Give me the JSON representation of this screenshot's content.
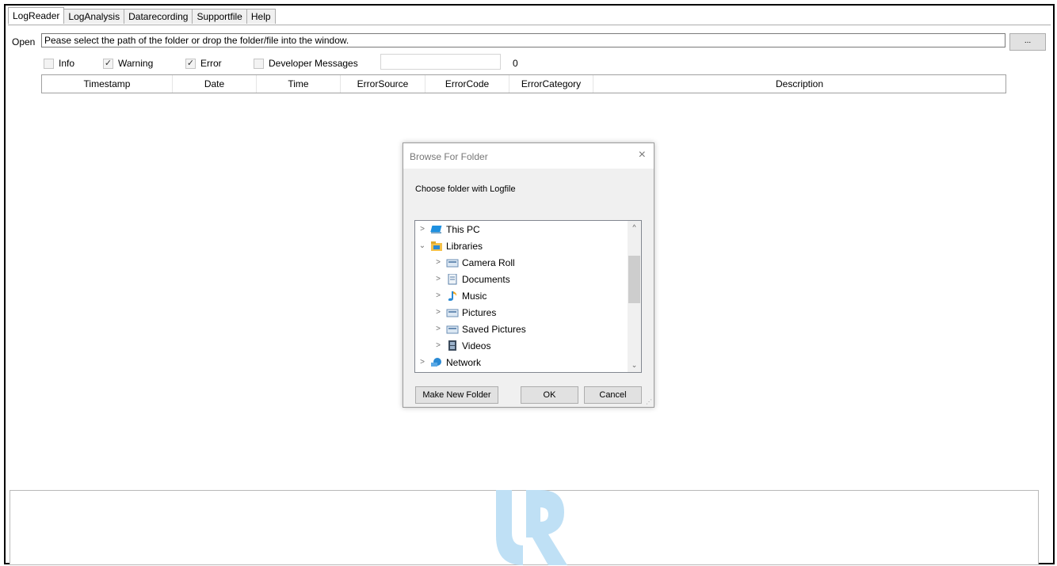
{
  "tabs": [
    {
      "label": "LogReader"
    },
    {
      "label": "LogAnalysis"
    },
    {
      "label": "Datarecording"
    },
    {
      "label": "Supportfile"
    },
    {
      "label": "Help"
    }
  ],
  "open": {
    "label": "Open",
    "path_text": "Pease select the path of the folder or drop the folder/file into the window.",
    "browse_label": "..."
  },
  "filters": {
    "info": {
      "label": "Info",
      "checked": false
    },
    "warning": {
      "label": "Warning",
      "checked": true
    },
    "error": {
      "label": "Error",
      "checked": true
    },
    "developer": {
      "label": "Developer Messages",
      "checked": false
    },
    "count": "0"
  },
  "table": {
    "columns": [
      "Timestamp",
      "Date",
      "Time",
      "ErrorSource",
      "ErrorCode",
      "ErrorCategory",
      "Description"
    ]
  },
  "dialog": {
    "title": "Browse For Folder",
    "close": "×",
    "prompt": "Choose folder with Logfile",
    "tree": [
      {
        "label": "This PC",
        "icon": "computer-icon",
        "expanded": false
      },
      {
        "label": "Libraries",
        "icon": "folder-icon",
        "expanded": true
      },
      {
        "label": "Camera Roll",
        "icon": "library-icon"
      },
      {
        "label": "Documents",
        "icon": "documents-icon"
      },
      {
        "label": "Music",
        "icon": "music-icon"
      },
      {
        "label": "Pictures",
        "icon": "library-icon"
      },
      {
        "label": "Saved Pictures",
        "icon": "library-icon"
      },
      {
        "label": "Videos",
        "icon": "videos-icon"
      },
      {
        "label": "Network",
        "icon": "network-icon"
      }
    ],
    "buttons": {
      "new_folder": "Make New Folder",
      "ok": "OK",
      "cancel": "Cancel"
    }
  },
  "colors": {
    "logo": "#bfe0f5",
    "accent": "#0078d7"
  }
}
